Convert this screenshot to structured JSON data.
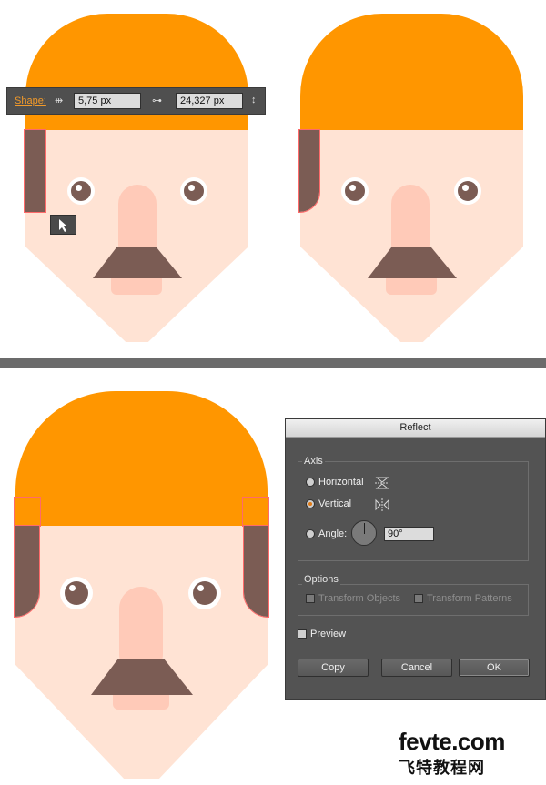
{
  "colors": {
    "hair": "#ff9600",
    "skin": "#ffe3d4",
    "brown": "#7b5c54",
    "nose": "#ffcab8",
    "panel": "#535353",
    "accent": "#f29a2a"
  },
  "shape_toolbar": {
    "label": "Shape:",
    "width_icon": "width-icon",
    "width_value": "5,75 px",
    "link_icon": "link-icon",
    "height_value": "24,327 px",
    "height_icon": "height-icon"
  },
  "reflect_dialog": {
    "title": "Reflect",
    "axis_group": "Axis",
    "horizontal_label": "Horizontal",
    "vertical_label": "Vertical",
    "angle_label": "Angle:",
    "angle_value": "90°",
    "selected_axis": "Vertical",
    "options_group": "Options",
    "transform_objects_label": "Transform Objects",
    "transform_patterns_label": "Transform Patterns",
    "preview_label": "Preview",
    "copy_button": "Copy",
    "cancel_button": "Cancel",
    "ok_button": "OK"
  },
  "watermark": {
    "line1": "fevte.com",
    "line2": "飞特教程网"
  }
}
